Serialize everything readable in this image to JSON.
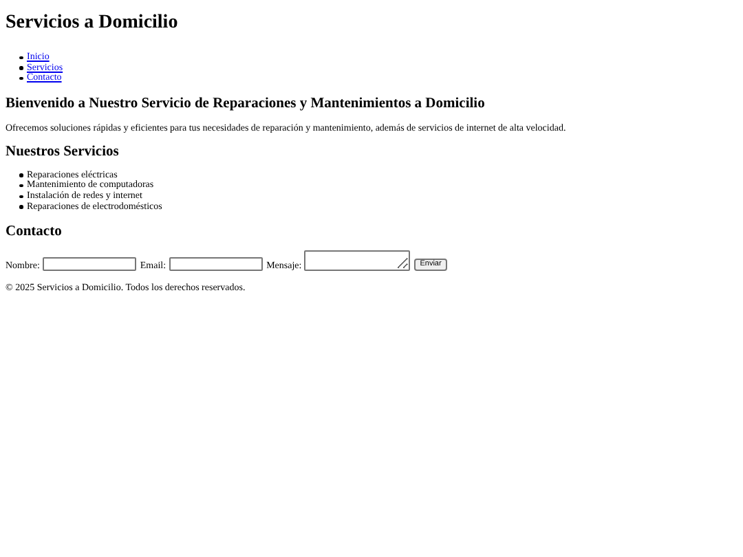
{
  "header": {
    "title": "Servicios a Domicilio"
  },
  "nav": [
    {
      "label": "Inicio"
    },
    {
      "label": "Servicios"
    },
    {
      "label": "Contacto"
    }
  ],
  "welcome": {
    "heading": "Bienvenido a Nuestro Servicio de Reparaciones y Mantenimientos a Domicilio",
    "text": "Ofrecemos soluciones rápidas y eficientes para tus necesidades de reparación y mantenimiento, además de servicios de internet de alta velocidad."
  },
  "services": {
    "heading": "Nuestros Servicios",
    "items": [
      "Reparaciones eléctricas",
      "Mantenimiento de computadoras",
      "Instalación de redes y internet",
      "Reparaciones de electrodomésticos"
    ]
  },
  "contact": {
    "heading": "Contacto",
    "fields": [
      {
        "label": "Nombre:",
        "kind": "input"
      },
      {
        "label": "Email:",
        "kind": "input"
      },
      {
        "label": "Mensaje:",
        "kind": "textarea"
      }
    ],
    "submit": "Enviar"
  },
  "footer": "© 2025 Servicios a Domicilio. Todos los derechos reservados."
}
